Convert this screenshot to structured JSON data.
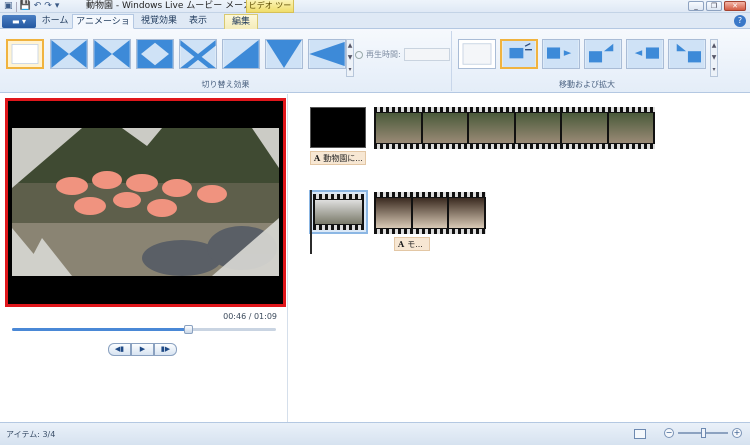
{
  "titlebar": {
    "title": "動物園 - Windows Live ムービー メーカー",
    "contextual_tool": "ビデオ ツール",
    "qat_icons": [
      "save-icon",
      "undo-icon",
      "redo-icon",
      "dropdown-icon"
    ]
  },
  "tabs": {
    "file": "▬ ▾",
    "items": [
      "ホーム",
      "アニメーション",
      "視覚効果",
      "表示",
      "編集"
    ],
    "active": "アニメーション"
  },
  "ribbon": {
    "transitions_label": "切り替え効果",
    "duration_label": "再生時間:",
    "duration_value": "",
    "pan_zoom_label": "移動および拡大"
  },
  "preview": {
    "timecode": "00:46 / 01:09",
    "progress": 0.667,
    "controls": [
      "◀▮",
      "▶",
      "▮▶"
    ]
  },
  "storyboard": {
    "caption1": "動物園に...",
    "caption2": "モ..."
  },
  "status": {
    "items": "アイテム: 3/4",
    "zoom_minus": "−",
    "zoom_plus": "+",
    "zoom_level": 0.5
  },
  "colors": {
    "accent": "#4a88d6",
    "selection_border": "#e0161b",
    "selected_thumb": "#f0b33f"
  }
}
